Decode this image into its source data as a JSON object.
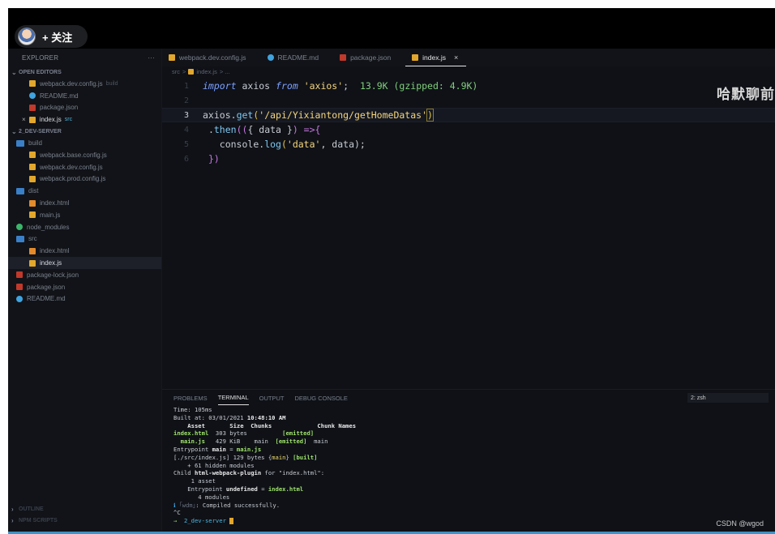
{
  "overlay": {
    "follow_label": "+ 关注"
  },
  "sidebar": {
    "title": "EXPLORER",
    "more": "···",
    "open_editors_label": "OPEN EDITORS",
    "open_editors": [
      {
        "name": "webpack.dev.config.js",
        "sub": "build",
        "icon": "js-file-icon"
      },
      {
        "name": "README.md",
        "sub": "",
        "icon": "info-icon"
      },
      {
        "name": "package.json",
        "sub": "",
        "icon": "npm-icon"
      },
      {
        "name": "index.js",
        "sub": "src",
        "icon": "js-file-icon",
        "close": "×"
      }
    ],
    "project_label": "2_DEV-SERVER",
    "tree": [
      {
        "name": "build",
        "icon": "folder-icon"
      },
      {
        "name": "webpack.base.config.js",
        "icon": "js-file-icon"
      },
      {
        "name": "webpack.dev.config.js",
        "icon": "js-file-icon"
      },
      {
        "name": "webpack.prod.config.js",
        "icon": "js-file-icon"
      },
      {
        "name": "dist",
        "icon": "folder-icon"
      },
      {
        "name": "index.html",
        "icon": "html-file-icon"
      },
      {
        "name": "main.js",
        "icon": "js-file-icon"
      },
      {
        "name": "node_modules",
        "icon": "node-folder-icon"
      },
      {
        "name": "src",
        "icon": "folder-icon"
      },
      {
        "name": "index.html",
        "icon": "html-file-icon"
      },
      {
        "name": "index.js",
        "icon": "js-file-icon"
      },
      {
        "name": "package-lock.json",
        "icon": "lock-file-icon"
      },
      {
        "name": "package.json",
        "icon": "npm-icon"
      },
      {
        "name": "README.md",
        "icon": "info-icon"
      }
    ],
    "outline_label": "OUTLINE",
    "npm_label": "NPM SCRIPTS"
  },
  "tabs": [
    {
      "label": "webpack.dev.config.js",
      "icon": "js-file-icon"
    },
    {
      "label": "README.md",
      "icon": "info-icon"
    },
    {
      "label": "package.json",
      "icon": "npm-icon"
    },
    {
      "label": "index.js",
      "icon": "js-file-icon",
      "close": "×"
    }
  ],
  "breadcrumb": {
    "folder": "src",
    "sep": ">",
    "file": "index.js",
    "rest": "> ..."
  },
  "editor": {
    "lines": [
      {
        "n": "1",
        "kw1": "import",
        "id1": "axios",
        "kw2": "from",
        "str1": "'axios'",
        "semi": ";",
        "hint": "13.9K (gzipped: 4.9K)"
      },
      {
        "n": "2"
      },
      {
        "n": "3",
        "obj": "axios",
        "dot": ".",
        "fn": "get",
        "open": "(",
        "str": "'/api/Yixiantong/getHomeDatas'",
        "close": ")"
      },
      {
        "n": "4",
        "dot": ".",
        "fn": "then",
        "open": "((",
        "brace": "{ data }",
        "mid": ") =>",
        "open2": " {"
      },
      {
        "n": "5",
        "obj": "console",
        "dot": ".",
        "fn": "log",
        "args_open": "(",
        "str": "'data'",
        "rest": ", data);"
      },
      {
        "n": "6",
        "close": "})"
      }
    ],
    "watermark": "哈默聊前"
  },
  "panel": {
    "tabs": [
      "PROBLEMS",
      "TERMINAL",
      "OUTPUT",
      "DEBUG CONSOLE"
    ],
    "active_tab": "TERMINAL",
    "shell": "2: zsh",
    "terminal": {
      "time": "Time: 105ms",
      "built_at_label": "Built at: 03/01/2021 ",
      "built_at_time": "10:48:10 AM",
      "header": "    Asset       Size  Chunks             Chunk Names",
      "asset1_name": "index.html",
      "asset1_rest": "  303 bytes          ",
      "asset1_tag": "[emitted]",
      "asset2_name": "  main.js",
      "asset2_rest": "   429 KiB    main  ",
      "asset2_tag": "[emitted]",
      "asset2_chunk": "  main",
      "entry_label": "Entrypoint ",
      "entry_main": "main",
      "entry_eq": " = ",
      "entry_file": "main.js",
      "src_line_a": "[./src/index.js] 129 bytes {",
      "src_line_main": "main",
      "src_line_b": "} ",
      "src_line_built": "[built]",
      "hidden": "    + 61 hidden modules",
      "child_a": "Child ",
      "child_b": "html-webpack-plugin",
      "child_c": " for \"index.html\":",
      "child_asset": "     1 asset",
      "child_entry_a": "    Entrypoint ",
      "child_entry_b": "undefined",
      "child_entry_c": " = ",
      "child_entry_d": "index.html",
      "child_modules": "       4 modules",
      "wdm_a": "ℹ ",
      "wdm_b": "｢wdm｣",
      "wdm_c": ": Compiled successfully.",
      "ctrl": "^C",
      "prompt_arrow": "→ ",
      "prompt_dir": " 2_dev-server "
    }
  },
  "credit": "CSDN @wgod",
  "colors": {
    "accent": "#3a95c8",
    "string": "#f5d67c",
    "keyword": "#7aa0ff",
    "function": "#7ec8ef"
  }
}
